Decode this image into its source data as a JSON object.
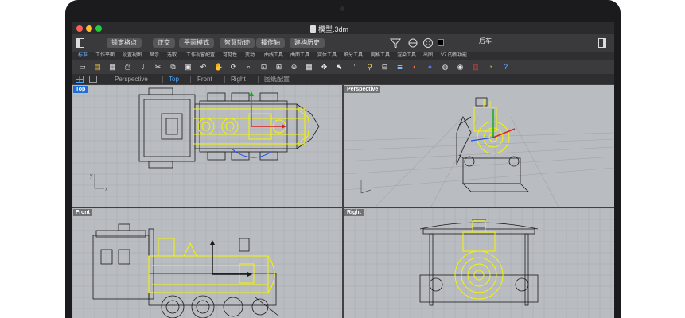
{
  "window": {
    "title": "模型.3dm",
    "traffic_colors": [
      "#ff5f57",
      "#febc2e",
      "#28c840"
    ]
  },
  "command_bar": {
    "buttons": [
      "锁定格点",
      "正交",
      "平面模式",
      "智慧轨迹",
      "操作轴",
      "建构历史"
    ],
    "right_label": "后车"
  },
  "tabs": {
    "items": [
      "标准",
      "工作平面",
      "设置视图",
      "显示",
      "选取",
      "工作视窗配置",
      "可见性",
      "变动",
      "曲线工具",
      "曲面工具",
      "实体工具",
      "细分工具",
      "网格工具",
      "渲染工具",
      "出图",
      "V7 的新功能"
    ],
    "active_index": 0
  },
  "toolbar": {
    "icons": [
      "new-file-icon",
      "open-file-icon",
      "save-icon",
      "print-icon",
      "import-icon",
      "cut-icon",
      "copy-icon",
      "paste-icon",
      "undo-icon",
      "pan-icon",
      "rotate-view-icon",
      "zoom-icon",
      "zoom-window-icon",
      "zoom-extents-icon",
      "zoom-selected-icon",
      "grid-icon",
      "move-icon",
      "select-icon",
      "points-on-icon",
      "lightbulb-icon",
      "lock-icon",
      "layer-icon",
      "material-icon",
      "render-sphere-icon",
      "environment-icon",
      "render-preview-icon",
      "display-mode-icon",
      "color-wheel-icon",
      "help-icon"
    ]
  },
  "view_tabs": {
    "items": [
      "Perspective",
      "Top",
      "Front",
      "Right",
      "图纸配置"
    ],
    "active_index": 1
  },
  "viewports": [
    {
      "label": "Top",
      "active": true
    },
    {
      "label": "Perspective",
      "active": false
    },
    {
      "label": "Front",
      "active": false
    },
    {
      "label": "Right",
      "active": false
    }
  ],
  "axis_labels": {
    "x": "x",
    "y": "y",
    "z": "z"
  },
  "colors": {
    "viewport_bg": "#b9bcc1",
    "grid": "#a6a9ae",
    "wire": "#1a1a1a",
    "selected": "#f4f400",
    "gumball_x": "#e02020",
    "gumball_y": "#10b010",
    "gumball_z": "#2050e0",
    "active_label": "#1e6ed8"
  }
}
